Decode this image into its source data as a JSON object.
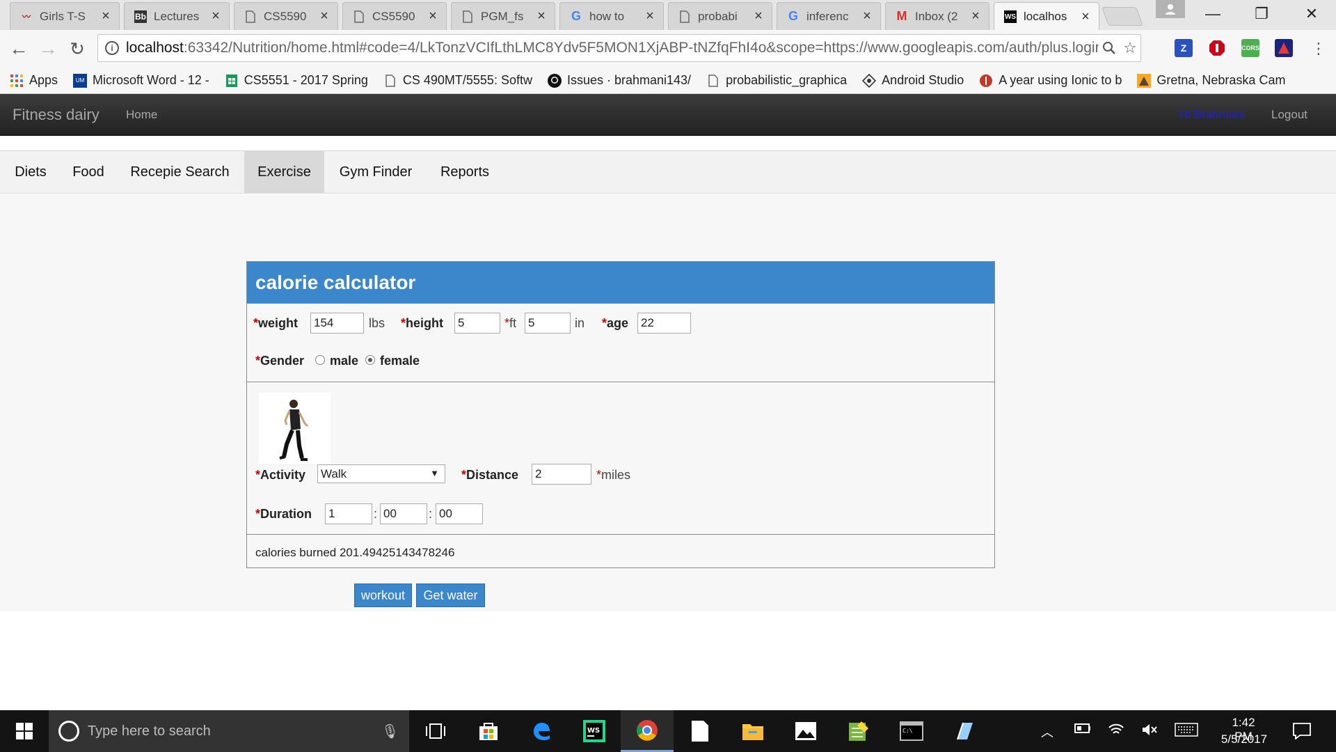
{
  "browser": {
    "tabs": [
      {
        "title": "Girls T-S",
        "icon": "hollister-icon",
        "icon_color": "#b22222"
      },
      {
        "title": "Lectures",
        "icon": "blackboard-icon",
        "icon_color": "#222222"
      },
      {
        "title": "CS5590",
        "icon": "page-icon",
        "icon_color": "#666666"
      },
      {
        "title": "CS5590",
        "icon": "page-icon",
        "icon_color": "#666666"
      },
      {
        "title": "PGM_fs",
        "icon": "page-icon",
        "icon_color": "#666666"
      },
      {
        "title": "how to",
        "icon": "google-icon",
        "icon_color": "#4285f4"
      },
      {
        "title": "probabi",
        "icon": "page-icon",
        "icon_color": "#666666"
      },
      {
        "title": "inferenc",
        "icon": "google-icon",
        "icon_color": "#4285f4"
      },
      {
        "title": "Inbox (2",
        "icon": "gmail-icon",
        "icon_color": "#d93025"
      },
      {
        "title": "localhos",
        "icon": "webstorm-icon",
        "icon_color": "#000000"
      }
    ],
    "url_host": "localhost",
    "url_rest": ":63342/Nutrition/home.html#code=4/LkTonzVCIfLthLMC8Ydv5F5MON1XjABP-tNZfqFhI4o&scope=https://www.googleapis.com/auth/plus.login",
    "bookmarks": [
      {
        "label": "Apps",
        "icon": "apps-grid-icon"
      },
      {
        "label": "Microsoft Word - 12 -",
        "icon": "umkc-icon"
      },
      {
        "label": "CS5551 - 2017 Spring",
        "icon": "sheets-icon"
      },
      {
        "label": "CS 490MT/5555: Softw",
        "icon": "page-icon"
      },
      {
        "label": "Issues · brahmani143/",
        "icon": "github-icon"
      },
      {
        "label": "probabilistic_graphica",
        "icon": "page-icon"
      },
      {
        "label": "Android Studio",
        "icon": "android-studio-icon"
      },
      {
        "label": "A year using Ionic to b",
        "icon": "ionic-icon"
      },
      {
        "label": "Gretna, Nebraska Cam",
        "icon": "camping-icon"
      }
    ],
    "extensions": [
      "zotero-icon",
      "adblock-icon",
      "cors-icon",
      "translate-icon"
    ],
    "ext_labels": {
      "zotero": "Z",
      "cors": "CORS"
    }
  },
  "app": {
    "brand": "Fitness dairy",
    "nav_home": "Home",
    "greeting": "Hi Brahmani",
    "logout": "Logout",
    "menu": [
      "Diets",
      "Food",
      "Recepie Search",
      "Exercise",
      "Gym Finder",
      "Reports"
    ],
    "active_menu": "Exercise"
  },
  "calculator": {
    "title": "calorie calculator",
    "weight_label": "weight",
    "weight_value": "154",
    "weight_unit": "lbs",
    "height_label": "height",
    "height_ft_value": "5",
    "height_ft_unit": "ft",
    "height_in_value": "5",
    "height_in_unit": "in",
    "age_label": "age",
    "age_value": "22",
    "gender_label": "Gender",
    "gender_options": [
      "male",
      "female"
    ],
    "gender_selected": "female",
    "activity_label": "Activity",
    "activity_value": "Walk",
    "distance_label": "Distance",
    "distance_value": "2",
    "distance_unit": "miles",
    "duration_label": "Duration",
    "duration_hours": "1",
    "duration_minutes": "00",
    "duration_seconds": "00",
    "result": "calories burned 201.49425143478246",
    "required_mark": "*",
    "time_sep": ":"
  },
  "buttons": {
    "workout": "workout",
    "get_water": "Get water"
  },
  "taskbar": {
    "search_placeholder": "Type here to search",
    "time": "1:42 PM",
    "date": "5/5/2017",
    "apps": [
      "task-view-icon",
      "store-icon",
      "edge-icon",
      "webstorm-icon",
      "chrome-icon",
      "notepad-icon",
      "file-explorer-icon",
      "photos-icon",
      "sheets-editor-icon",
      "cmd-icon",
      "paint-icon"
    ],
    "active_app": "chrome-icon"
  },
  "colors": {
    "accent": "#3c86cb",
    "navbar": "#222222",
    "required": "#cc0000",
    "greeting": "#1f1fd6"
  }
}
